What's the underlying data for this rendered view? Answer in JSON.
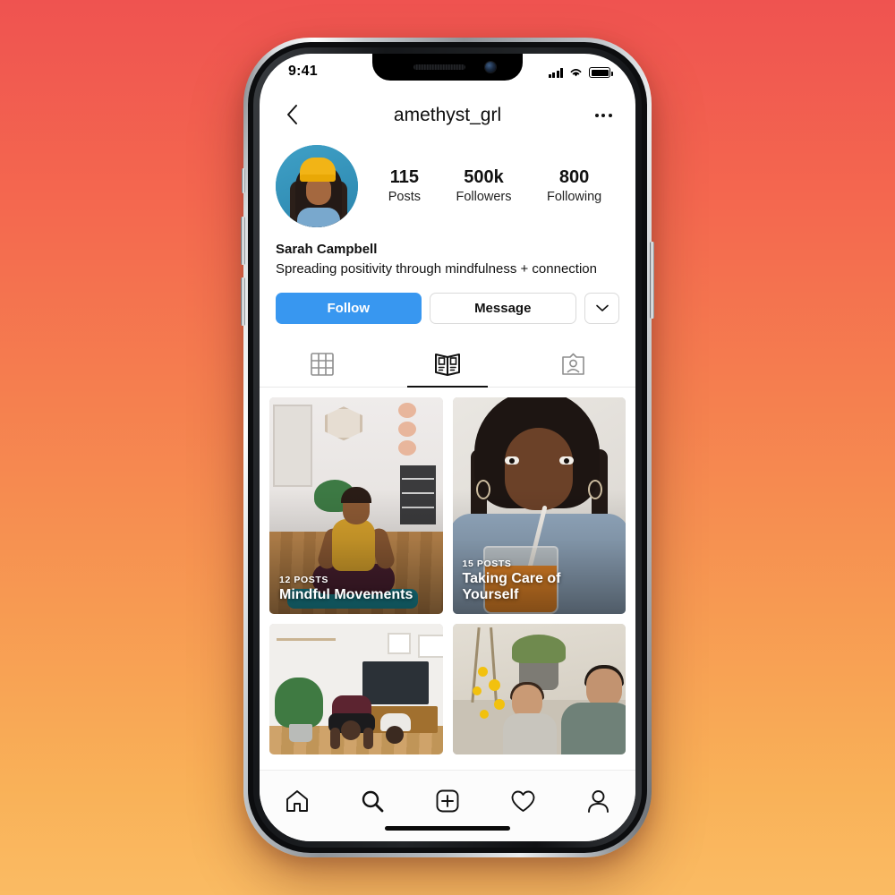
{
  "status_bar": {
    "time": "9:41",
    "signal_icon": "cellular-signal-icon",
    "wifi_icon": "wifi-icon",
    "battery_icon": "battery-full-icon"
  },
  "nav": {
    "back_icon": "chevron-left-icon",
    "title": "amethyst_grl",
    "more_icon": "more-options-icon"
  },
  "profile": {
    "avatar_alt": "profile-photo-woman-yellow-beanie",
    "stats": [
      {
        "value": "115",
        "label": "Posts"
      },
      {
        "value": "500k",
        "label": "Followers"
      },
      {
        "value": "800",
        "label": "Following"
      }
    ],
    "display_name": "Sarah Campbell",
    "bio": "Spreading positivity through mindfulness + connection"
  },
  "actions": {
    "follow_label": "Follow",
    "follow_color": "#3897f0",
    "message_label": "Message",
    "chevron_icon": "chevron-down-icon"
  },
  "tabs": [
    {
      "name": "grid",
      "icon": "grid-icon",
      "active": false
    },
    {
      "name": "guides",
      "icon": "guides-book-icon",
      "active": true
    },
    {
      "name": "tagged",
      "icon": "tagged-person-icon",
      "active": false
    }
  ],
  "guides": [
    {
      "count": "12 POSTS",
      "title": "Mindful Movements",
      "scene": "yoga-meditation"
    },
    {
      "count": "15 POSTS",
      "title": "Taking Care of Yourself",
      "scene": "woman-drinking-juice"
    },
    {
      "count": "",
      "title": "",
      "scene": "living-room-stretching"
    },
    {
      "count": "",
      "title": "",
      "scene": "garden-father-son"
    }
  ],
  "tabbar": [
    {
      "name": "home",
      "icon": "home-icon"
    },
    {
      "name": "search",
      "icon": "search-icon"
    },
    {
      "name": "create",
      "icon": "plus-square-icon"
    },
    {
      "name": "activity",
      "icon": "heart-icon"
    },
    {
      "name": "profile",
      "icon": "person-icon"
    }
  ],
  "background": {
    "gradient_top": "#ef5350",
    "gradient_bottom": "#fabb63"
  }
}
